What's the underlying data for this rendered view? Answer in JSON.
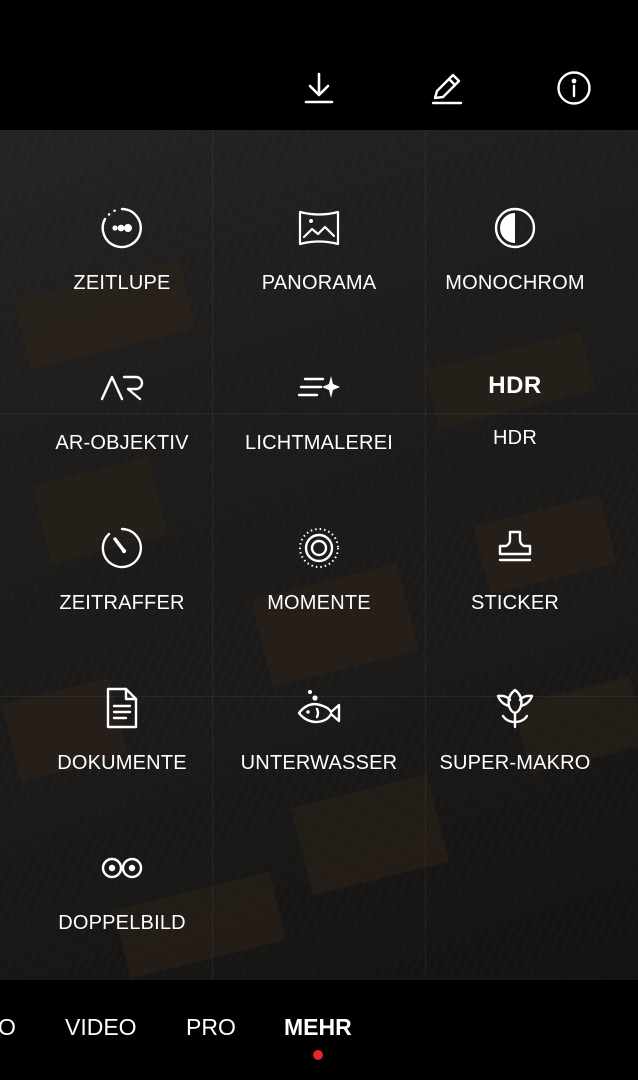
{
  "top_bar": {
    "icons": [
      "download-icon",
      "edit-icon",
      "info-icon"
    ]
  },
  "modes": [
    {
      "label": "ZEITLUPE",
      "icon": "slow-motion-icon"
    },
    {
      "label": "PANORAMA",
      "icon": "panorama-icon"
    },
    {
      "label": "MONOCHROM",
      "icon": "monochrome-icon"
    },
    {
      "label": "AR-OBJEKTIV",
      "icon": "ar-icon",
      "icon_text": "AR"
    },
    {
      "label": "LICHTMALEREI",
      "icon": "light-painting-icon"
    },
    {
      "label": "HDR",
      "icon": "hdr-icon",
      "icon_text": "HDR"
    },
    {
      "label": "ZEITRAFFER",
      "icon": "timelapse-icon"
    },
    {
      "label": "MOMENTE",
      "icon": "moments-icon"
    },
    {
      "label": "STICKER",
      "icon": "sticker-icon"
    },
    {
      "label": "DOKUMENTE",
      "icon": "document-icon"
    },
    {
      "label": "UNTERWASSER",
      "icon": "underwater-icon"
    },
    {
      "label": "SUPER-MAKRO",
      "icon": "super-macro-icon"
    },
    {
      "label": "DOPPELBILD",
      "icon": "dual-view-icon"
    }
  ],
  "bottom_tabs": [
    {
      "label": "O"
    },
    {
      "label": "VIDEO"
    },
    {
      "label": "PRO"
    },
    {
      "label": "MEHR",
      "active": true
    }
  ],
  "colors": {
    "background": "#000000",
    "text": "#ffffff",
    "active_indicator": "#e5262a"
  }
}
